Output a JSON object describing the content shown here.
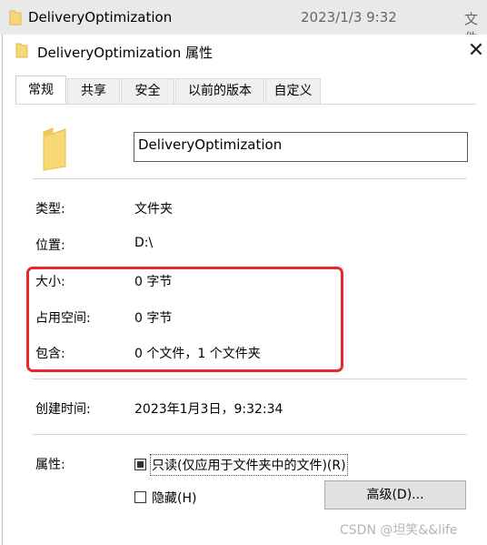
{
  "background_row": {
    "name": "DeliveryOptimization",
    "date": "2023/1/3 9:32",
    "type": "文件"
  },
  "dialog": {
    "title": "DeliveryOptimization 属性",
    "close_label": "✕"
  },
  "tabs": [
    {
      "label": "常规",
      "active": true
    },
    {
      "label": "共享",
      "active": false
    },
    {
      "label": "安全",
      "active": false
    },
    {
      "label": "以前的版本",
      "active": false
    },
    {
      "label": "自定义",
      "active": false
    }
  ],
  "folder_name_value": "DeliveryOptimization",
  "properties": [
    {
      "label": "类型:",
      "value": "文件夹"
    },
    {
      "label": "位置:",
      "value": "D:\\"
    },
    {
      "label": "大小:",
      "value": "0 字节"
    },
    {
      "label": "占用空间:",
      "value": "0 字节"
    },
    {
      "label": "包含:",
      "value": "0 个文件，1 个文件夹"
    },
    {
      "label": "创建时间:",
      "value": "2023年1月3日，9:32:34"
    }
  ],
  "attributes": {
    "label": "属性:",
    "readonly": {
      "label": "只读(仅应用于文件夹中的文件)(R)",
      "state": "indeterminate"
    },
    "hidden": {
      "label": "隐藏(H)",
      "checked": false
    },
    "advanced_button": "高级(D)..."
  },
  "watermark": "CSDN @坦笑&&life",
  "colors": {
    "highlight": "#e8262d",
    "folder": "#f8d775"
  }
}
